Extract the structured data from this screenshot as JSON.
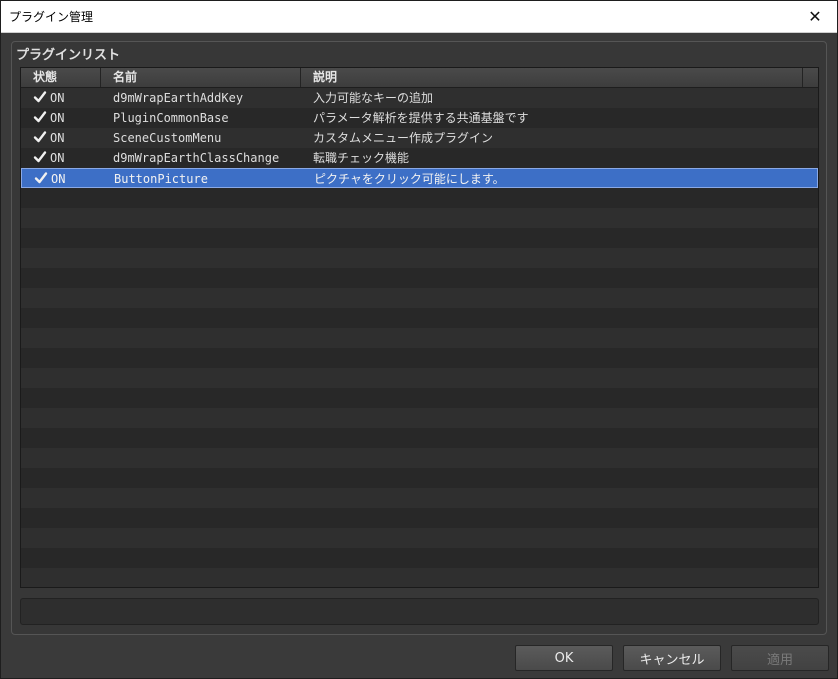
{
  "window": {
    "title": "プラグイン管理",
    "close_glyph": "✕"
  },
  "group": {
    "title": "プラグインリスト"
  },
  "columns": {
    "state": "状態",
    "name": "名前",
    "description": "説明"
  },
  "plugins": [
    {
      "state": "ON",
      "checked": true,
      "name": "d9mWrapEarthAddKey",
      "description": "入力可能なキーの追加",
      "selected": false
    },
    {
      "state": "ON",
      "checked": true,
      "name": "PluginCommonBase",
      "description": "パラメータ解析を提供する共通基盤です",
      "selected": false
    },
    {
      "state": "ON",
      "checked": true,
      "name": "SceneCustomMenu",
      "description": "カスタムメニュー作成プラグイン",
      "selected": false
    },
    {
      "state": "ON",
      "checked": true,
      "name": "d9mWrapEarthClassChange",
      "description": "転職チェック機能",
      "selected": false
    },
    {
      "state": "ON",
      "checked": true,
      "name": "ButtonPicture",
      "description": "ピクチャをクリック可能にします。",
      "selected": true
    }
  ],
  "status_text": "",
  "buttons": {
    "ok": "OK",
    "cancel": "キャンセル",
    "apply": "適用"
  },
  "colors": {
    "selection": "#3d6fc6",
    "background": "#3a3a3a"
  }
}
